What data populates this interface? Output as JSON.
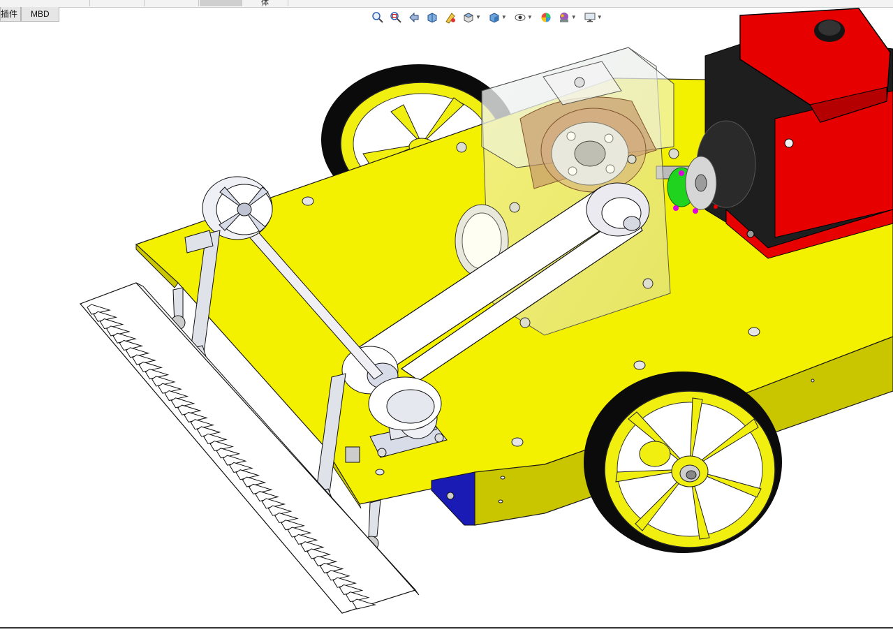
{
  "window": {
    "top_tab_stub": "体"
  },
  "tabs": [
    {
      "label": "插件",
      "active": false
    },
    {
      "label": "MBD",
      "active": false
    }
  ],
  "heads_up_toolbar": {
    "icons": [
      "zoom-to-fit-icon",
      "zoom-to-area-icon",
      "previous-view-icon",
      "section-view-icon",
      "dynamic-annotation-icon",
      "view-orientation-icon",
      "display-style-icon",
      "hide-show-items-icon",
      "edit-appearance-icon",
      "apply-scene-icon",
      "view-settings-icon"
    ]
  },
  "colors": {
    "deck_yellow": "#f3f000",
    "deck_side": "#c9c600",
    "engine_red": "#e60000",
    "engine_black": "#1e1e1e",
    "coupling_green": "#1fd31f",
    "support_blue": "#1a1ab5",
    "part_grey": "#d8dbe8"
  }
}
